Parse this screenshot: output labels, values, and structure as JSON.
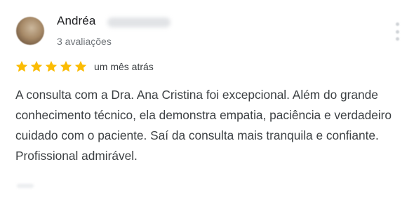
{
  "review": {
    "reviewer_name": "Andréa",
    "review_count": "3 avaliações",
    "rating": 5,
    "rating_max": 5,
    "time": "um mês atrás",
    "text": "A consulta com a Dra. Ana Cristina foi excepcional. Além do grande conhecimento técnico, ela demonstra empatia, paciência e verdadeiro cuidado com o paciente. Saí da consulta mais tranquila e confiante. Profissional admirável."
  },
  "colors": {
    "star": "#fbbc04",
    "name": "#202124",
    "secondary_text": "#70757a",
    "body_text": "#3c4043"
  },
  "icons": {
    "star": "star-icon",
    "more": "more-vertical-icon"
  }
}
